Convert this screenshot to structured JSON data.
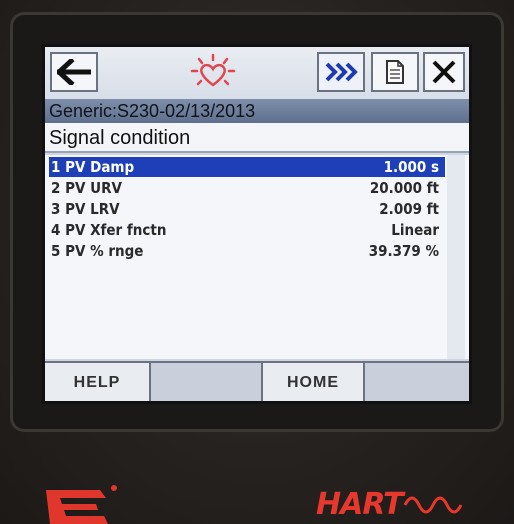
{
  "header": {
    "device_title": "Generic:S230-02/13/2013",
    "section_title": "Signal condition"
  },
  "toolbar": {
    "icons": [
      "back-arrow-icon",
      "heart-pulse-icon",
      "fast-forward-icon",
      "document-icon",
      "close-icon"
    ]
  },
  "list": {
    "items": [
      {
        "label": "1 PV Damp",
        "value": "1.000 s",
        "selected": true
      },
      {
        "label": "2 PV URV",
        "value": "20.000 ft"
      },
      {
        "label": "3 PV LRV",
        "value": "2.009 ft"
      },
      {
        "label": "4 PV Xfer fnctn",
        "value": "Linear"
      },
      {
        "label": "5 PV % rnge",
        "value": "39.379 %"
      }
    ]
  },
  "footer": {
    "help_label": "HELP",
    "home_label": "HOME"
  },
  "brand": {
    "hart_logo": "HART"
  },
  "colors": {
    "selection": "#1e3fb8",
    "title_bar": "#6a7b98",
    "hart_red": "#e8372c"
  }
}
